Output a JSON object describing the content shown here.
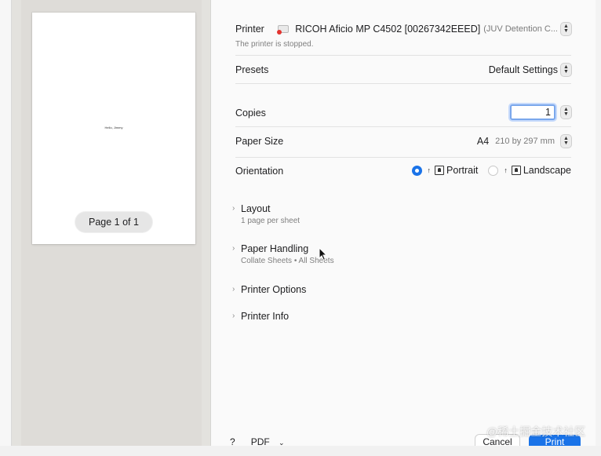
{
  "preview": {
    "page_text": "Hello, Jimmy",
    "page_indicator": "Page 1 of 1"
  },
  "printer": {
    "label": "Printer",
    "name": "RICOH Aficio MP C4502 [00267342EEED]",
    "location": "(JUV Detention C...",
    "status": "The printer is stopped."
  },
  "presets": {
    "label": "Presets",
    "value": "Default Settings"
  },
  "copies": {
    "label": "Copies",
    "value": "1"
  },
  "paper_size": {
    "label": "Paper Size",
    "value": "A4",
    "dimensions": "210 by 297 mm"
  },
  "orientation": {
    "label": "Orientation",
    "options": [
      "Portrait",
      "Landscape"
    ],
    "selected": "Portrait"
  },
  "sections": [
    {
      "label": "Layout",
      "sub": "1 page per sheet"
    },
    {
      "label": "Paper Handling",
      "sub": "Collate Sheets • All Sheets"
    },
    {
      "label": "Printer Options",
      "sub": ""
    },
    {
      "label": "Printer Info",
      "sub": ""
    }
  ],
  "footer": {
    "help": "?",
    "pdf": "PDF",
    "cancel": "Cancel",
    "print": "Print"
  },
  "watermark": "@稀土掘金技术社区",
  "colors": {
    "accent": "#1a73e8",
    "printer_error": "#e3342f"
  }
}
